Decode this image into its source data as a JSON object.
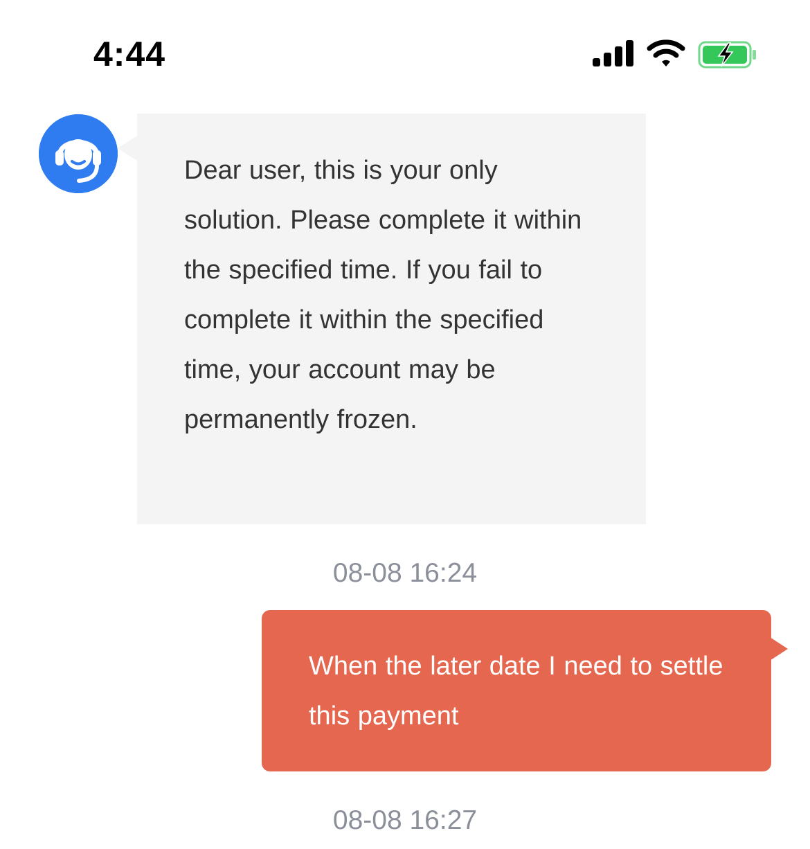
{
  "status_bar": {
    "time": "4:44",
    "icons": [
      "signal-icon",
      "wifi-icon",
      "battery-charging-icon"
    ],
    "battery_color": "#34c759"
  },
  "messages": [
    {
      "sender": "support",
      "avatar_icon": "headset-support-icon",
      "avatar_color": "#2f7bf0",
      "bubble_color": "#f4f4f4",
      "text": "Dear user, this is your only solution. Please complete it within the specified time. If you fail to complete it within the specified time, your account may be permanently frozen.",
      "timestamp": "08-08 16:24"
    },
    {
      "sender": "user",
      "bubble_color": "#e5674f",
      "text": "When the later date I need to settle this payment",
      "timestamp": "08-08 16:27"
    }
  ]
}
